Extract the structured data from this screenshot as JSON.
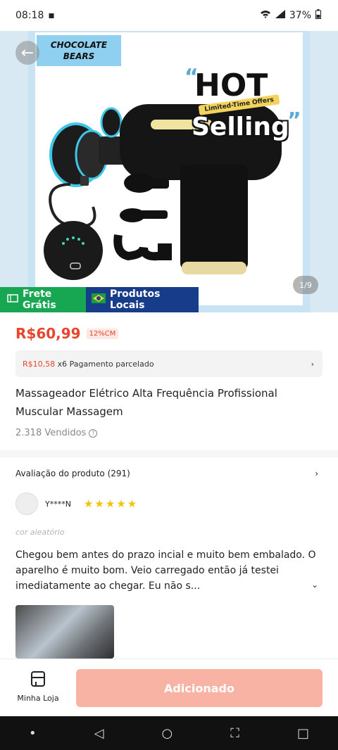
{
  "status": {
    "time": "08:18",
    "battery": "37%"
  },
  "hero": {
    "brand_line1": "CHOCOLATE",
    "brand_line2": "BEARS",
    "hot": "HOT",
    "limited": "Limited-Time Offers",
    "selling": "Selling",
    "counter": "1/9"
  },
  "badges": {
    "free_shipping": "Frete Grátis",
    "local": "Produtos Locais"
  },
  "price": {
    "value": "R$60,99",
    "discount": "12%CM"
  },
  "installment": {
    "amount": "R$10,58",
    "text": "x6 Pagamento parcelado"
  },
  "product": {
    "title": "Massageador Elétrico Alta Frequência Profissional Muscular Massagem",
    "sold": "2.318 Vendidos"
  },
  "reviews": {
    "header": "Avaliação do produto (291)",
    "reviewer": "Y****N",
    "variant": "cor aleatório",
    "text": "Chegou bem antes do prazo incial e muito bem embalado. O aparelho é muito bom. Veio carregado então já testei imediatamente ao chegar. Eu não s..."
  },
  "bottom": {
    "store": "Minha Loja",
    "add": "Adicionado"
  },
  "colors": {
    "price": "#e8452c",
    "green": "#17a652",
    "blue": "#173c8a",
    "add_button": "#f8b3a5"
  }
}
